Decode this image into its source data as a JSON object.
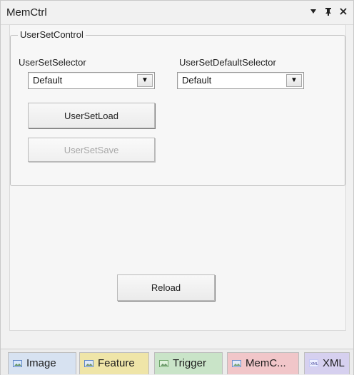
{
  "window": {
    "title": "MemCtrl"
  },
  "group": {
    "title": "UserSetControl"
  },
  "fields": {
    "user_set_selector_label": "UserSetSelector",
    "user_set_selector_value": "Default",
    "user_set_default_selector_label": "UserSetDefaultSelector",
    "user_set_default_selector_value": "Default"
  },
  "buttons": {
    "load": "UserSetLoad",
    "save": "UserSetSave",
    "reload": "Reload"
  },
  "tabs": [
    {
      "label": "Image",
      "icon": "image-icon"
    },
    {
      "label": "Feature",
      "icon": "feature-icon"
    },
    {
      "label": "Trigger",
      "icon": "trigger-icon"
    },
    {
      "label": "MemC...",
      "icon": "memctrl-icon"
    },
    {
      "label": "XML",
      "icon": "xml-icon"
    }
  ],
  "icons": {
    "pin": "pin-icon",
    "dock": "dock-icon",
    "close": "close-icon",
    "dropdown": "chevron-down-icon"
  },
  "colors": {
    "window_bg": "#f1f1f1",
    "panel_bg": "#f6f6f6",
    "image_tab": "#d7e2f1",
    "feature_tab": "#efe5a8",
    "trigger_tab": "#c9e4c8",
    "memctrl_tab": "#f1c6c9",
    "xml_tab": "#d6d0ef"
  }
}
